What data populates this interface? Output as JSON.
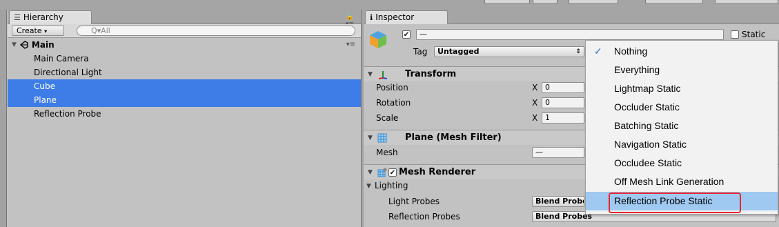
{
  "hierarchy": {
    "tab_title": "Hierarchy",
    "create_label": "Create",
    "search_placeholder": "Q▾All",
    "scene_name": "Main",
    "items": [
      {
        "label": "Main Camera",
        "selected": false
      },
      {
        "label": "Directional Light",
        "selected": false
      },
      {
        "label": "Cube",
        "selected": true
      },
      {
        "label": "Plane",
        "selected": true
      },
      {
        "label": "Reflection Probe",
        "selected": false
      }
    ]
  },
  "inspector": {
    "tab_title": "Inspector",
    "object_name": "—",
    "static_label": "Static",
    "tag_label": "Tag",
    "tag_value": "Untagged",
    "transform": {
      "title": "Transform",
      "position_label": "Position",
      "rotation_label": "Rotation",
      "scale_label": "Scale",
      "x_label": "X",
      "position_x": "0",
      "rotation_x": "0",
      "scale_x": "1"
    },
    "mesh_filter": {
      "title": "Plane (Mesh Filter)",
      "mesh_label": "Mesh",
      "mesh_value": "—"
    },
    "mesh_renderer": {
      "title": "Mesh Renderer",
      "lighting_label": "Lighting",
      "light_probes_label": "Light Probes",
      "light_probes_value": "Blend Probes",
      "reflection_probes_label": "Reflection Probes",
      "reflection_probes_value": "Blend Probes"
    }
  },
  "static_menu": {
    "items": [
      {
        "label": "Nothing",
        "checked": true
      },
      {
        "label": "Everything",
        "checked": false
      },
      {
        "label": "Lightmap Static",
        "checked": false
      },
      {
        "label": "Occluder Static",
        "checked": false
      },
      {
        "label": "Batching Static",
        "checked": false
      },
      {
        "label": "Navigation Static",
        "checked": false
      },
      {
        "label": "Occludee Static",
        "checked": false
      },
      {
        "label": "Off Mesh Link Generation",
        "checked": false
      },
      {
        "label": "Reflection Probe Static",
        "checked": false,
        "highlighted": true
      }
    ]
  },
  "colors": {
    "selection": "#3e7de7",
    "menu_highlight": "#9fc9f1",
    "annotation_box": "#e8282e"
  }
}
